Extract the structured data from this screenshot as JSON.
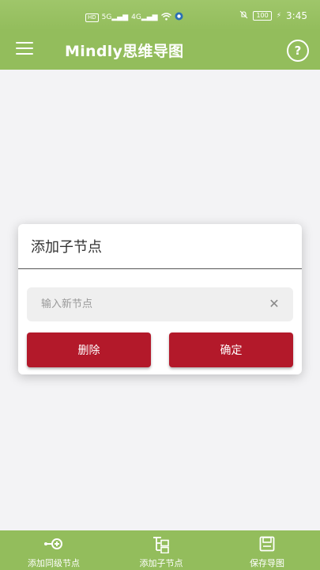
{
  "status_bar": {
    "left_chips": [
      "HD",
      "5G",
      "4G"
    ],
    "battery": "100",
    "time": "3:45"
  },
  "app_bar": {
    "title": "Mindly思维导图",
    "help_label": "?"
  },
  "dialog": {
    "title": "添加子节点",
    "input_placeholder": "输入新节点",
    "input_value": "",
    "clear_label": "✕",
    "delete_label": "删除",
    "confirm_label": "确定"
  },
  "bottom_nav": {
    "items": [
      {
        "label": "添加同级节点",
        "icon": "add-sibling-node-icon"
      },
      {
        "label": "添加子节点",
        "icon": "add-child-node-icon"
      },
      {
        "label": "保存导图",
        "icon": "save-icon"
      }
    ]
  },
  "colors": {
    "primary": "#93bd5c",
    "button": "#b3192a",
    "background": "#f3f3f5"
  }
}
